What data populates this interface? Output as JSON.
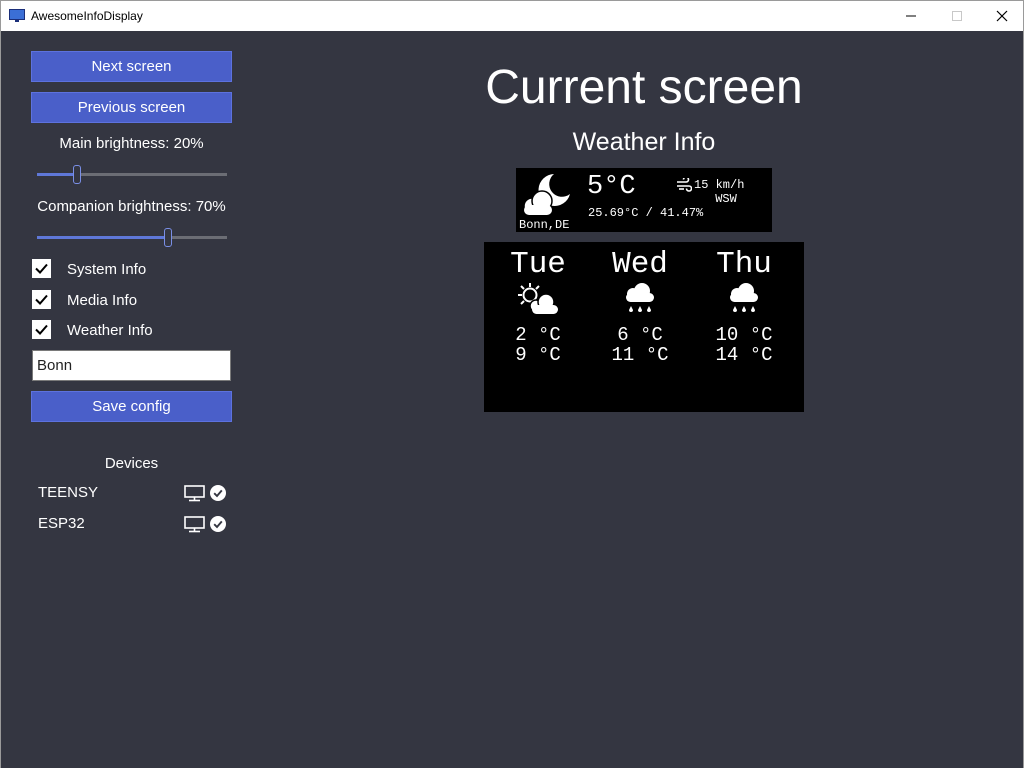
{
  "window": {
    "title": "AwesomeInfoDisplay",
    "controls": [
      "minimize",
      "maximize",
      "close"
    ]
  },
  "sidebar": {
    "next_screen_label": "Next screen",
    "previous_screen_label": "Previous screen",
    "main_brightness_label": "Main brightness: 20%",
    "main_brightness_value": 20,
    "companion_brightness_label": "Companion brightness: 70%",
    "companion_brightness_value": 70,
    "checkboxes": [
      {
        "label": "System Info",
        "checked": true
      },
      {
        "label": "Media Info",
        "checked": true
      },
      {
        "label": "Weather Info",
        "checked": true
      }
    ],
    "city_input_value": "Bonn",
    "save_config_label": "Save config",
    "devices_heading": "Devices",
    "devices": [
      {
        "name": "TEENSY",
        "icons": [
          "monitor-icon",
          "check-circle-icon"
        ]
      },
      {
        "name": "ESP32",
        "icons": [
          "monitor-icon",
          "check-circle-icon"
        ]
      }
    ]
  },
  "main": {
    "title": "Current screen",
    "screen_name": "Weather Info",
    "current_weather": {
      "icon": "moon-cloud-icon",
      "temperature": "5°C",
      "wind_icon": "wind-icon",
      "wind_speed": "15 km/h",
      "wind_direction": "WSW",
      "details": "25.69°C / 41.47%",
      "location": "Bonn,DE"
    },
    "forecast": [
      {
        "day": "Tue",
        "icon": "sun-cloud-icon",
        "low": "2 °C",
        "high": "9 °C"
      },
      {
        "day": "Wed",
        "icon": "rain-cloud-icon",
        "low": "6 °C",
        "high": "11 °C"
      },
      {
        "day": "Thu",
        "icon": "rain-cloud-icon",
        "low": "10 °C",
        "high": "14 °C"
      }
    ]
  },
  "colors": {
    "background": "#343641",
    "accent": "#4a5fc9",
    "display_panel": "#000000"
  }
}
